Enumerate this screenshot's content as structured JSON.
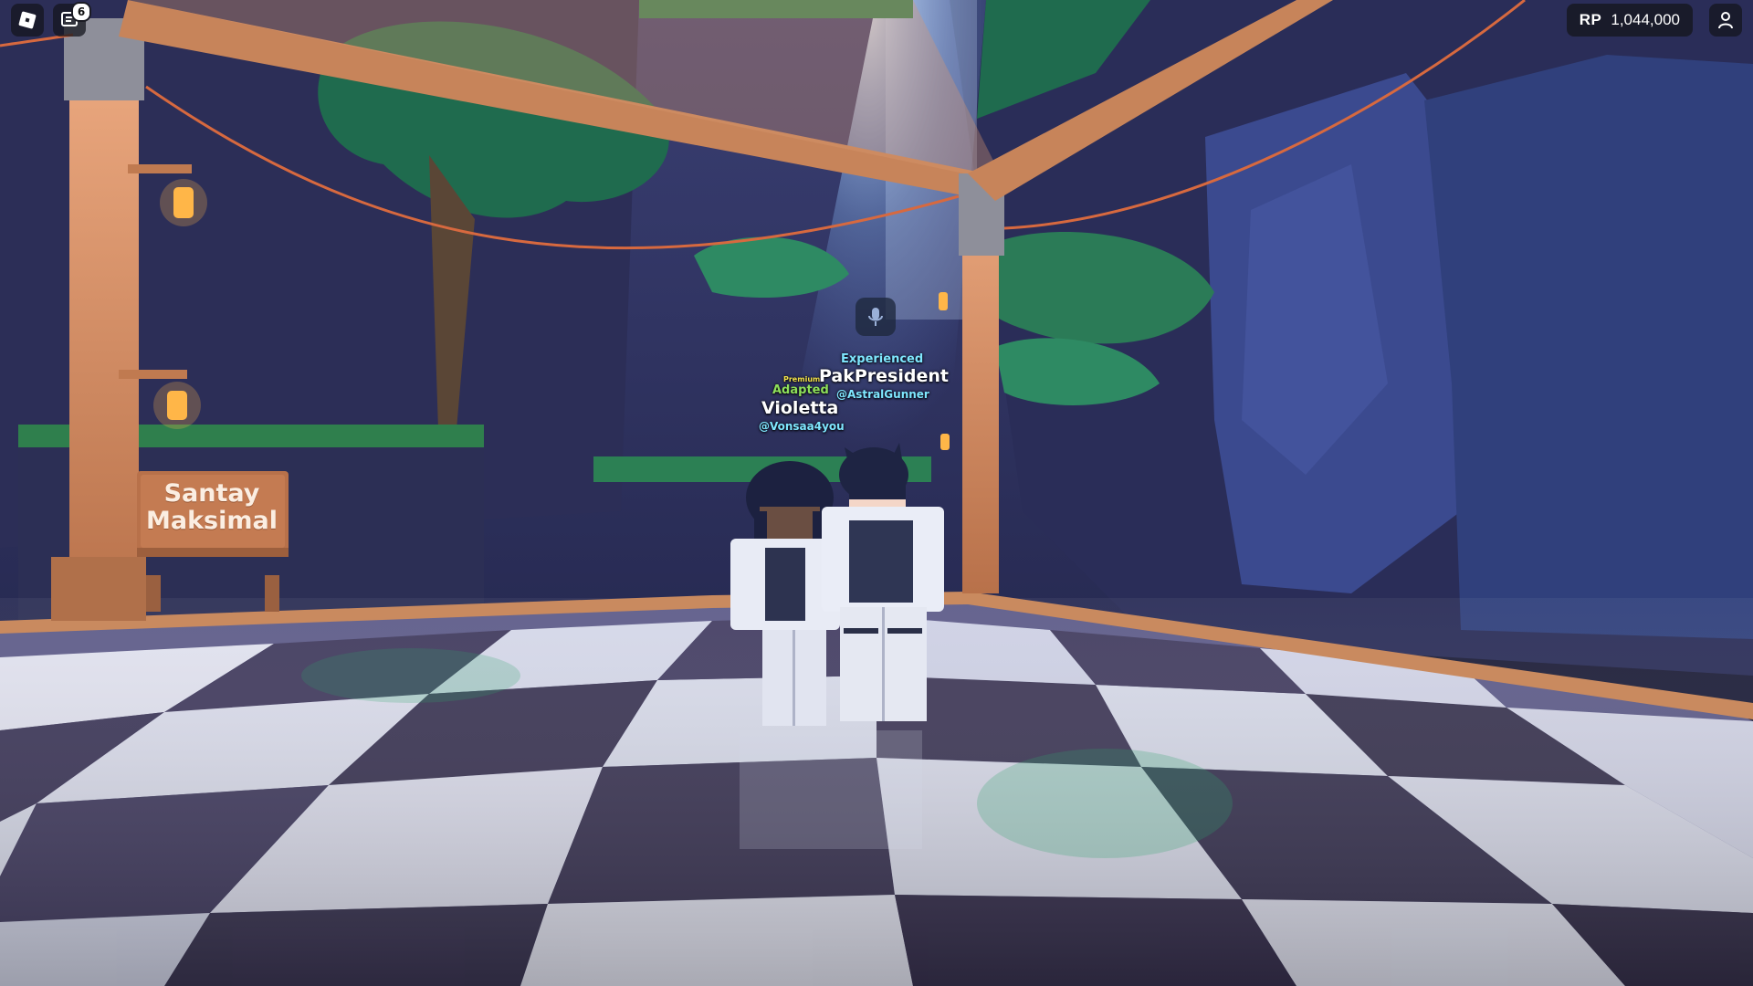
{
  "hud": {
    "roblox_menu_icon": "roblox-logo-icon",
    "chat_icon": "chat-icon",
    "chat_badge": "6",
    "currency_label": "RP",
    "currency_value": "1,044,000",
    "profile_icon": "person-icon"
  },
  "players": [
    {
      "title_small": "Premium",
      "title": "Adapted",
      "display_name": "Violetta",
      "username": "@Vonsaa4you"
    },
    {
      "title": "Experienced",
      "display_name": "PakPresident",
      "username": "@AstralGunner"
    }
  ],
  "voice_chat_icon": "microphone-icon",
  "sign": {
    "line1": "Santay",
    "line2": "Maksimal"
  },
  "colors": {
    "tag_yellow": "#f4e34a",
    "tag_green": "#8ee05a",
    "tag_cyan": "#7fe7ff",
    "tag_white": "#ffffff",
    "sign_wood": "#b8714a"
  }
}
